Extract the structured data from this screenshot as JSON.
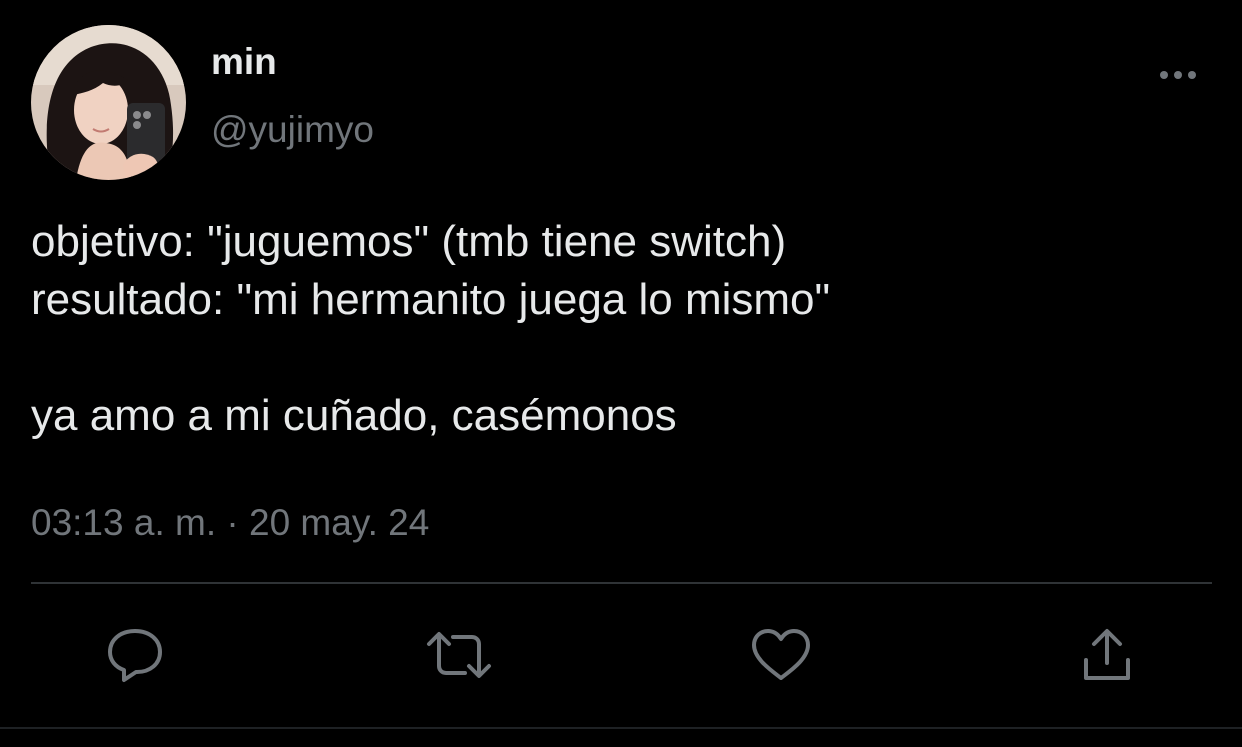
{
  "author": {
    "display_name": "min",
    "handle": "@yujimyo"
  },
  "tweet": {
    "text": "objetivo: \"juguemos\" (tmb tiene switch)\nresultado: \"mi hermanito juega lo mismo\"\n\nya amo a mi cuñado, casémonos",
    "timestamp": "03:13 a. m. · 20 may. 24"
  },
  "icons": {
    "more": "more-horizontal-icon",
    "reply": "reply-bubble-icon",
    "retweet": "retweet-icon",
    "like": "heart-icon",
    "share": "share-upload-icon"
  },
  "colors": {
    "background": "#000000",
    "primary_text": "#e7e9ea",
    "secondary_text": "#71767b",
    "divider": "#2f3336"
  }
}
